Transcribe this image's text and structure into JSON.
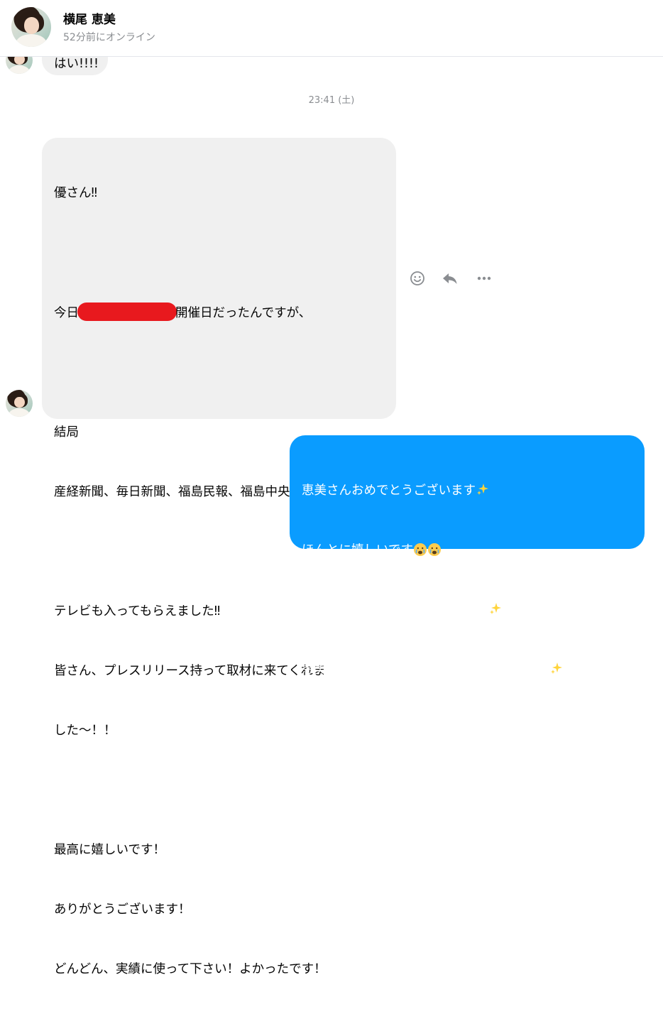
{
  "contact": {
    "name": "横尾 恵美",
    "status": "52分前にオンライン"
  },
  "messages": {
    "prev_incoming": "はい!!!!",
    "timestamp": "23:41 (土)",
    "incoming": {
      "line1": "優さん‼",
      "line2_before": "今日",
      "line2_after": "開催日だったんですが、",
      "line3": "結局",
      "line4": "産経新聞、毎日新聞、福島民報、福島中央テレビ",
      "line5": "テレビも入ってもらえました‼",
      "line6": "皆さん、プレスリリース持って取材に来てくれま",
      "line7": "した～！！",
      "line8": "最高に嬉しいです！",
      "line9": "ありがとうございます！",
      "line10": "どんどん、実績に使って下さい！よかったです！"
    },
    "outgoing": {
      "line1": "恵美さんおめでとうございます",
      "line2": "ほんとに嬉しいです",
      "line3": "心から良かったッ！！テレビまで",
      "line4": "恵美さんの想いがしっかり伝わったんですね"
    }
  },
  "actions": {
    "react_icon": "smiley-icon",
    "reply_icon": "reply-icon",
    "more_icon": "more-icon"
  },
  "colors": {
    "incoming_bubble": "#f0f0f0",
    "outgoing_bubble": "#0a9cff",
    "redaction": "#e8191e"
  }
}
